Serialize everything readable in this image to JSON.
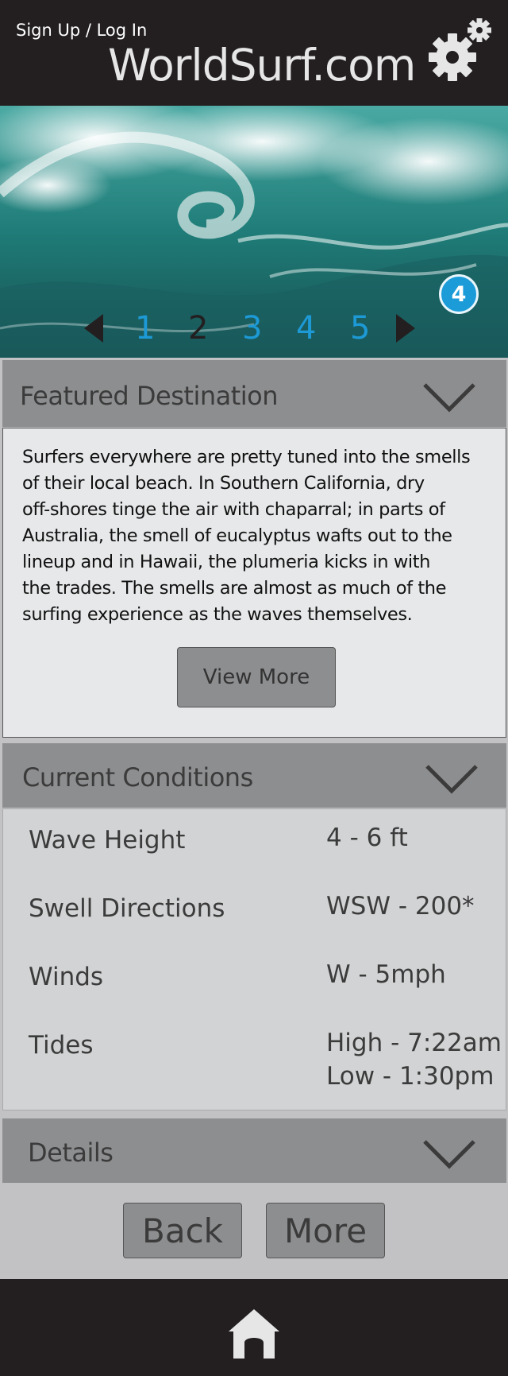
{
  "header": {
    "auth_link": "Sign Up / Log In",
    "site_title": "WorldSurf.com",
    "settings_icon": "gear-icon"
  },
  "hero": {
    "image_alt": "ocean-wave-image",
    "slide_badge": "4",
    "pages": [
      "1",
      "2",
      "3",
      "4",
      "5"
    ],
    "current_page": "2"
  },
  "featured": {
    "title": "Featured Destination",
    "body_lines": [
      "Surfers everywhere are pretty tuned into the smells",
      "of their local beach.  In Southern California, dry",
      "off-shores tinge the air with chaparral; in parts of",
      "Australia, the smell of eucalyptus wafts out to the",
      "lineup and in Hawaii, the plumeria kicks in with",
      "the trades.  The smells are almost as much of the",
      "surfing experience as the waves themselves."
    ],
    "view_more": "View More"
  },
  "conditions": {
    "title": "Current Conditions",
    "rows": [
      {
        "label": "Wave Height",
        "value": "4 - 6 ft"
      },
      {
        "label": "Swell Directions",
        "value": "WSW - 200*"
      },
      {
        "label": "Winds",
        "value": "W - 5mph"
      },
      {
        "label": "Tides",
        "value": "High - 7:22am",
        "value2": "Low - 1:30pm"
      }
    ]
  },
  "details": {
    "title": "Details"
  },
  "buttons": {
    "back": "Back",
    "more": "More"
  },
  "footer": {
    "home_icon": "home-icon"
  },
  "colors": {
    "header_bg": "#231f20",
    "accent_blue": "#1d9ad6",
    "section_header": "#8d8e90",
    "page_bg": "#c2c2c4"
  }
}
